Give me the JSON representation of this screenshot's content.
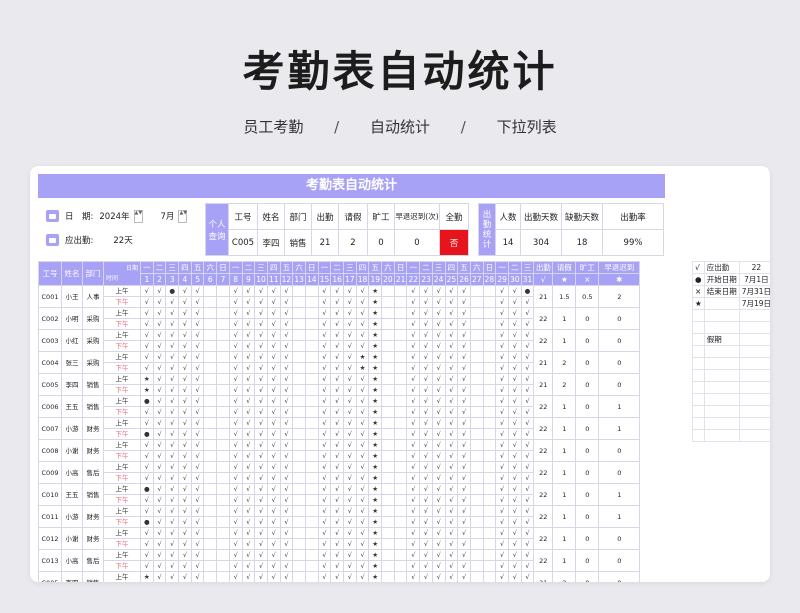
{
  "header": {
    "title": "考勤表自动统计",
    "sub": [
      "员工考勤",
      "/",
      "自动统计",
      "/",
      "下拉列表"
    ]
  },
  "banner": "考勤表自动统计",
  "info": {
    "date_label": "日　期:",
    "year": "2024年",
    "month": "7月",
    "attendance_label": "应出勤:",
    "attendance_value": "22天"
  },
  "personal": {
    "label": "个人查询",
    "headers": [
      "工号",
      "姓名",
      "部门",
      "出勤",
      "请假",
      "旷工",
      "早退迟到(次)",
      "全勤"
    ],
    "values": [
      "C005",
      "李四",
      "销售",
      "21",
      "2",
      "0",
      "0",
      "否"
    ]
  },
  "dept": {
    "label": "出勤统计",
    "headers": [
      "人数",
      "出勤天数",
      "缺勤天数",
      "出勤率"
    ],
    "values": [
      "14",
      "304",
      "18",
      "99%"
    ]
  },
  "table": {
    "head1": [
      "工号",
      "姓名",
      "部门",
      "日期",
      "出勤",
      "请假",
      "旷工",
      "早退迟到"
    ],
    "time_label": "时间",
    "weekdays": [
      "一",
      "二",
      "三",
      "四",
      "五",
      "六",
      "日",
      "一",
      "二",
      "三",
      "四",
      "五",
      "六",
      "日",
      "一",
      "二",
      "三",
      "四",
      "五",
      "六",
      "日",
      "一",
      "二",
      "三",
      "四",
      "五",
      "六",
      "日",
      "一",
      "二",
      "三"
    ],
    "days": [
      "1",
      "2",
      "3",
      "4",
      "5",
      "6",
      "7",
      "8",
      "9",
      "10",
      "11",
      "12",
      "13",
      "14",
      "15",
      "16",
      "17",
      "18",
      "19",
      "20",
      "21",
      "22",
      "23",
      "24",
      "25",
      "26",
      "27",
      "28",
      "29",
      "30",
      "31"
    ],
    "sub_marks": [
      "√",
      "★",
      "×",
      "✱"
    ],
    "am": "上午",
    "pm": "下午",
    "rows": [
      {
        "id": "C001",
        "name": "小王",
        "dept": "人事",
        "am": "√√●√√··√√√√√··√√√√★··√√√√√··√√●",
        "pm": "√√√√√··√√√√√··√√√√★··√√√√√··√√√",
        "stats": [
          "21",
          "1.5",
          "0.5",
          "2"
        ]
      },
      {
        "id": "C002",
        "name": "小明",
        "dept": "采购",
        "am": "√√√√√··√√√√√··√√√√★··√√√√√··√√√",
        "pm": "√√√√√··√√√√√··√√√√★··√√√√√··√√√",
        "stats": [
          "22",
          "1",
          "0",
          "0"
        ]
      },
      {
        "id": "C003",
        "name": "小红",
        "dept": "采购",
        "am": "√√√√√··√√√√√··√√√√★··√√√√√··√√√",
        "pm": "√√√√√··√√√√√··√√√√★··√√√√√··√√√",
        "stats": [
          "22",
          "1",
          "0",
          "0"
        ]
      },
      {
        "id": "C004",
        "name": "张三",
        "dept": "采购",
        "am": "√√√√√··√√√√√··√√√★★··√√√√√··√√√",
        "pm": "√√√√√··√√√√√··√√√★★··√√√√√··√√√",
        "stats": [
          "21",
          "2",
          "0",
          "0"
        ]
      },
      {
        "id": "C005",
        "name": "李四",
        "dept": "销售",
        "am": "★√√√√··√√√√√··√√√√★··√√√√√··√√√",
        "pm": "★√√√√··√√√√√··√√√√★··√√√√√··√√√",
        "stats": [
          "21",
          "2",
          "0",
          "0"
        ]
      },
      {
        "id": "C006",
        "name": "王五",
        "dept": "销售",
        "am": "●√√√√··√√√√√··√√√√★··√√√√√··√√√",
        "pm": "√√√√√··√√√√√··√√√√★··√√√√√··√√√",
        "stats": [
          "22",
          "1",
          "0",
          "1"
        ]
      },
      {
        "id": "C007",
        "name": "小游",
        "dept": "财务",
        "am": "√√√√√··√√√√√··√√√√★··√√√√√··√√√",
        "pm": "●√√√√··√√√√√··√√√√★··√√√√√··√√√",
        "stats": [
          "22",
          "1",
          "0",
          "1"
        ]
      },
      {
        "id": "C008",
        "name": "小谢",
        "dept": "财务",
        "am": "√√√√√··√√√√√··√√√√★··√√√√√··√√√",
        "pm": "√√√√√··√√√√√··√√√√★··√√√√√··√√√",
        "stats": [
          "22",
          "1",
          "0",
          "0"
        ]
      },
      {
        "id": "C009",
        "name": "小高",
        "dept": "售后",
        "am": "√√√√√··√√√√√··√√√√★··√√√√√··√√√",
        "pm": "√√√√√··√√√√√··√√√√★··√√√√√··√√√",
        "stats": [
          "22",
          "1",
          "0",
          "0"
        ]
      },
      {
        "id": "C010",
        "name": "王五",
        "dept": "销售",
        "am": "●√√√√··√√√√√··√√√√★··√√√√√··√√√",
        "pm": "√√√√√··√√√√√··√√√√★··√√√√√··√√√",
        "stats": [
          "22",
          "1",
          "0",
          "1"
        ]
      },
      {
        "id": "C011",
        "name": "小游",
        "dept": "财务",
        "am": "√√√√√··√√√√√··√√√√★··√√√√√··√√√",
        "pm": "●√√√√··√√√√√··√√√√★··√√√√√··√√√",
        "stats": [
          "22",
          "1",
          "0",
          "1"
        ]
      },
      {
        "id": "C012",
        "name": "小谢",
        "dept": "财务",
        "am": "√√√√√··√√√√√··√√√√★··√√√√√··√√√",
        "pm": "√√√√√··√√√√√··√√√√★··√√√√√··√√√",
        "stats": [
          "22",
          "1",
          "0",
          "0"
        ]
      },
      {
        "id": "C013",
        "name": "小高",
        "dept": "售后",
        "am": "√√√√√··√√√√√··√√√√★··√√√√√··√√√",
        "pm": "√√√√√··√√√√√··√√√√★··√√√√√··√√√",
        "stats": [
          "22",
          "1",
          "0",
          "0"
        ]
      },
      {
        "id": "C005",
        "name": "李四",
        "dept": "销售",
        "am": "★√√√√··√√√√√··√√√√★··√√√√√··√√√",
        "pm": "★√√√√··√√√√√··√√√√★··√√√√√··√√√",
        "stats": [
          "21",
          "2",
          "0",
          "0"
        ]
      }
    ]
  },
  "legend": [
    [
      "√",
      "应出勤",
      "22"
    ],
    [
      "●",
      "开始日期",
      "7月1日"
    ],
    [
      "×",
      "结束日期",
      "7月31日"
    ],
    [
      "★",
      "",
      "7月19日"
    ],
    [
      "",
      "",
      ""
    ],
    [
      "",
      "",
      ""
    ],
    [
      "",
      "假期",
      ""
    ],
    [
      "",
      "",
      ""
    ],
    [
      "",
      "",
      ""
    ],
    [
      "",
      "",
      ""
    ],
    [
      "",
      "",
      ""
    ],
    [
      "",
      "",
      ""
    ],
    [
      "",
      "",
      ""
    ],
    [
      "",
      "",
      ""
    ],
    [
      "",
      "",
      ""
    ]
  ]
}
